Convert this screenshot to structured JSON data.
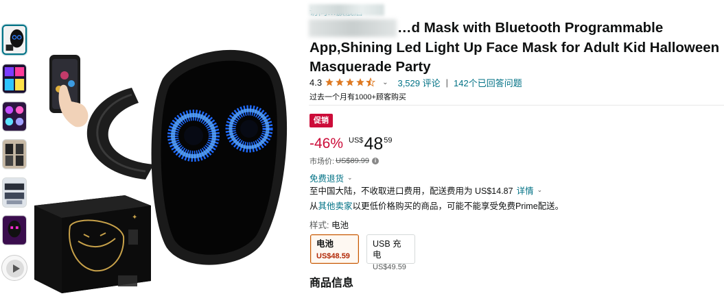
{
  "store": {
    "name": "访问…旗舰店"
  },
  "product": {
    "title_line1": "…d Mask with Bluetooth Programmable App,Shining",
    "title_rest": "Led Light Up Face Mask for Adult Kid Halloween Masquerade Party",
    "rating": "4.3",
    "rating_stars": 4.3,
    "ratings_count": "3,529 评论",
    "answered_questions": "142个已回答问题",
    "bought_past_month": "过去一个月有1000+顾客购买"
  },
  "deal": {
    "badge": "促销"
  },
  "price": {
    "discount": "-46%",
    "currency": "US$",
    "whole": "48",
    "fraction": "59",
    "list_label": "市场价:",
    "list_value": "US$89.99"
  },
  "delivery": {
    "free_returns": "免费退货",
    "shipping_text": "至中国大陆，不收取进口费用，配送费用为 US$14.87",
    "details_link": "详情",
    "other_sellers_prefix": "从",
    "other_sellers_link": "其他卖家",
    "other_sellers_suffix": "以更低价格购买的商品，可能不能享受免费Prime配送。"
  },
  "style": {
    "label": "样式:",
    "selected": "电池",
    "options": [
      {
        "name": "电池",
        "price": "US$48.59",
        "selected": true
      },
      {
        "name": "USB 充电",
        "price": "US$49.59",
        "selected": false
      }
    ]
  },
  "sections": {
    "product_info": "商品信息"
  },
  "colors": {
    "link": "#007185",
    "deal_red": "#cc0c39",
    "star": "#de7921",
    "selected_border": "#c45500"
  },
  "icons": {
    "share": "share-icon",
    "info": "info-icon",
    "chevron": "chevron-down-icon"
  }
}
